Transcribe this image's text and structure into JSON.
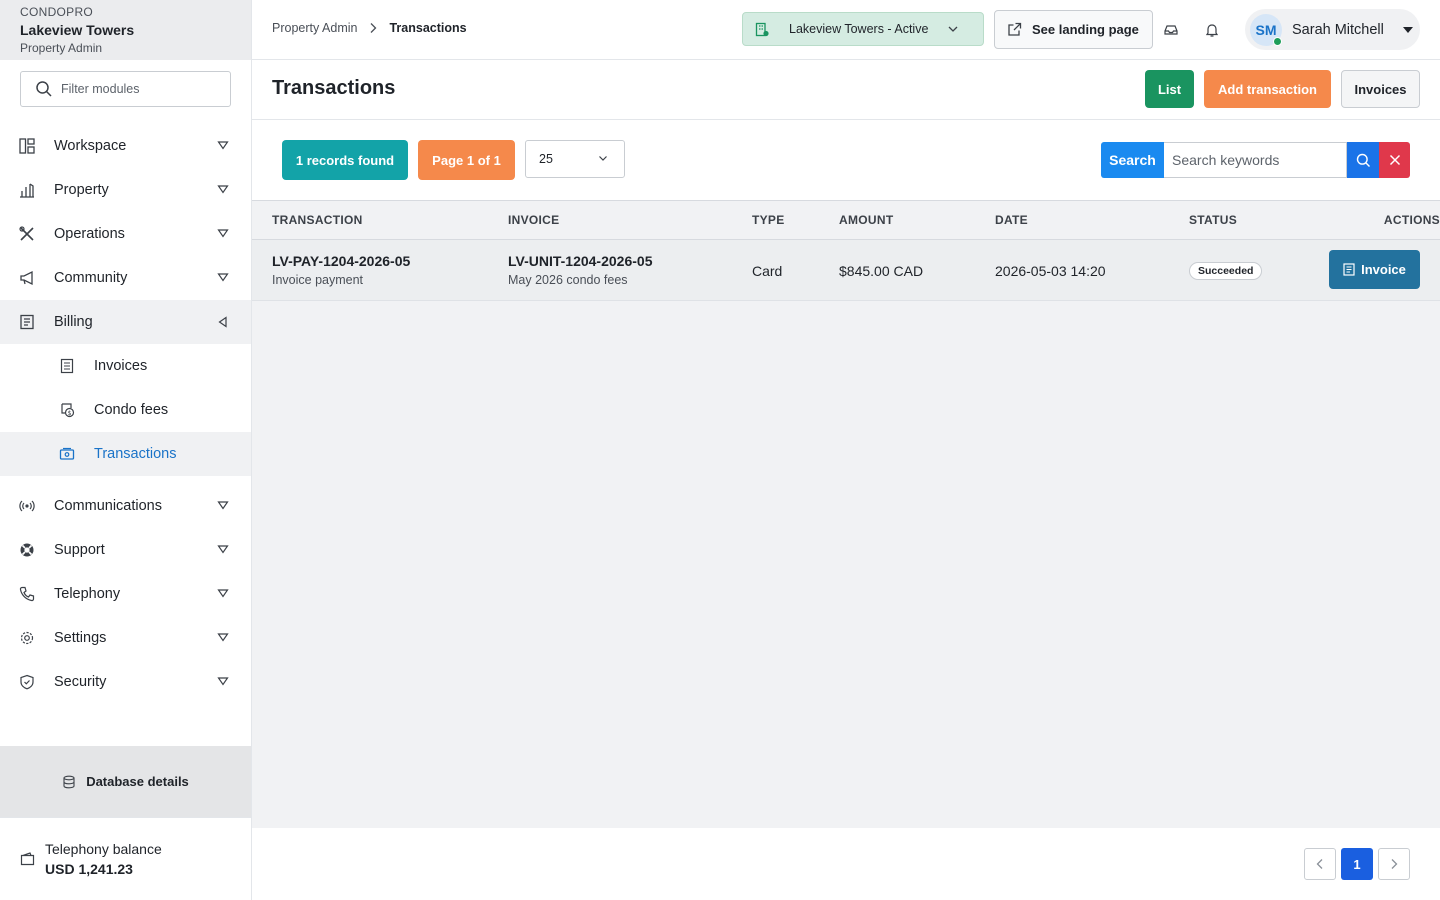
{
  "brand": {
    "app": "CONDOPRO",
    "name": "Lakeview Towers",
    "role": "Property Admin"
  },
  "sidebar": {
    "filter_placeholder": "Filter modules",
    "items": [
      {
        "label": "Workspace",
        "icon": "layout-grid-icon"
      },
      {
        "label": "Property",
        "icon": "building-chart-icon"
      },
      {
        "label": "Operations",
        "icon": "tools-icon"
      },
      {
        "label": "Community",
        "icon": "megaphone-icon"
      },
      {
        "label": "Billing",
        "icon": "invoice-icon",
        "expanded": true
      },
      {
        "label": "Communications",
        "icon": "broadcast-icon"
      },
      {
        "label": "Support",
        "icon": "lifebuoy-icon"
      },
      {
        "label": "Telephony",
        "icon": "phone-icon"
      },
      {
        "label": "Settings",
        "icon": "gear-icon"
      },
      {
        "label": "Security",
        "icon": "shield-icon"
      }
    ],
    "billing_sub": [
      {
        "label": "Invoices",
        "icon": "invoice-icon"
      },
      {
        "label": "Condo fees",
        "icon": "coin-receipt-icon"
      },
      {
        "label": "Transactions",
        "icon": "cash-icon",
        "active": true
      }
    ],
    "db_details": "Database details",
    "telephony_balance_label": "Telephony balance",
    "telephony_balance_value": "USD 1,241.23"
  },
  "topbar": {
    "breadcrumb": [
      "Property Admin",
      "Transactions"
    ],
    "property_select": "Lakeview Towers - Active",
    "landing_button": "See landing page",
    "user_initials": "SM",
    "user_name": "Sarah Mitchell"
  },
  "page": {
    "title": "Transactions",
    "buttons": {
      "list": "List",
      "add": "Add transaction",
      "invoices": "Invoices"
    }
  },
  "toolbar": {
    "records": "1 records found",
    "page": "Page 1 of 1",
    "per_page": "25",
    "search_label": "Search",
    "search_placeholder": "Search keywords"
  },
  "table": {
    "headers": [
      "TRANSACTION",
      "INVOICE",
      "TYPE",
      "AMOUNT",
      "DATE",
      "STATUS",
      "ACTIONS"
    ],
    "rows": [
      {
        "transaction_id": "LV-PAY-1204-2026-05",
        "transaction_desc": "Invoice payment",
        "invoice_id": "LV-UNIT-1204-2026-05",
        "invoice_desc": "May 2026 condo fees",
        "type": "Card",
        "amount": "$845.00 CAD",
        "date": "2026-05-03 14:20",
        "status": "Succeeded",
        "action": "Invoice"
      }
    ]
  },
  "pagination": {
    "current": "1"
  },
  "colors": {
    "list_green": "#1a9460",
    "add_orange": "#f5894b",
    "records_teal": "#13a3a8",
    "search_blue": "#1a8af0",
    "clear_red": "#e0384b",
    "row_action_blue": "#23729e",
    "active_link": "#1a73c8"
  }
}
